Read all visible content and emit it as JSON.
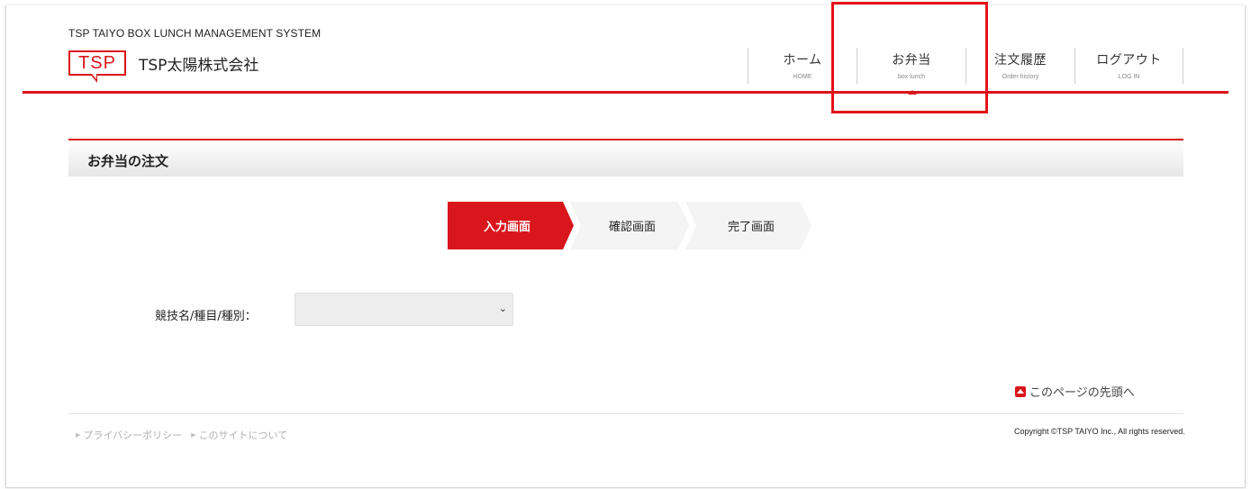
{
  "header": {
    "system_title": "TSP TAIYO BOX LUNCH MANAGEMENT SYSTEM",
    "logo_text": "TSP",
    "company_name": "TSP太陽株式会社"
  },
  "nav": {
    "items": [
      {
        "label": "ホーム",
        "sub": "HOME"
      },
      {
        "label": "お弁当",
        "sub": "box lunch"
      },
      {
        "label": "注文履歴",
        "sub": "Order history"
      },
      {
        "label": "ログアウト",
        "sub": "LOG IN"
      }
    ],
    "active_index": 1
  },
  "section": {
    "title": "お弁当の注文"
  },
  "steps": [
    {
      "label": "入力画面",
      "active": true
    },
    {
      "label": "確認画面",
      "active": false
    },
    {
      "label": "完了画面",
      "active": false
    }
  ],
  "form": {
    "event_label": "競技名/種目/種別：",
    "event_value": ""
  },
  "back_to_top": "このページの先頭へ",
  "footer": {
    "links": [
      "プライバシーポリシー",
      "このサイトについて"
    ],
    "copyright": "Copyright ©TSP TAIYO Inc., All rights reserved."
  },
  "colors": {
    "accent": "#d9161c",
    "highlight": "#e3141a"
  }
}
